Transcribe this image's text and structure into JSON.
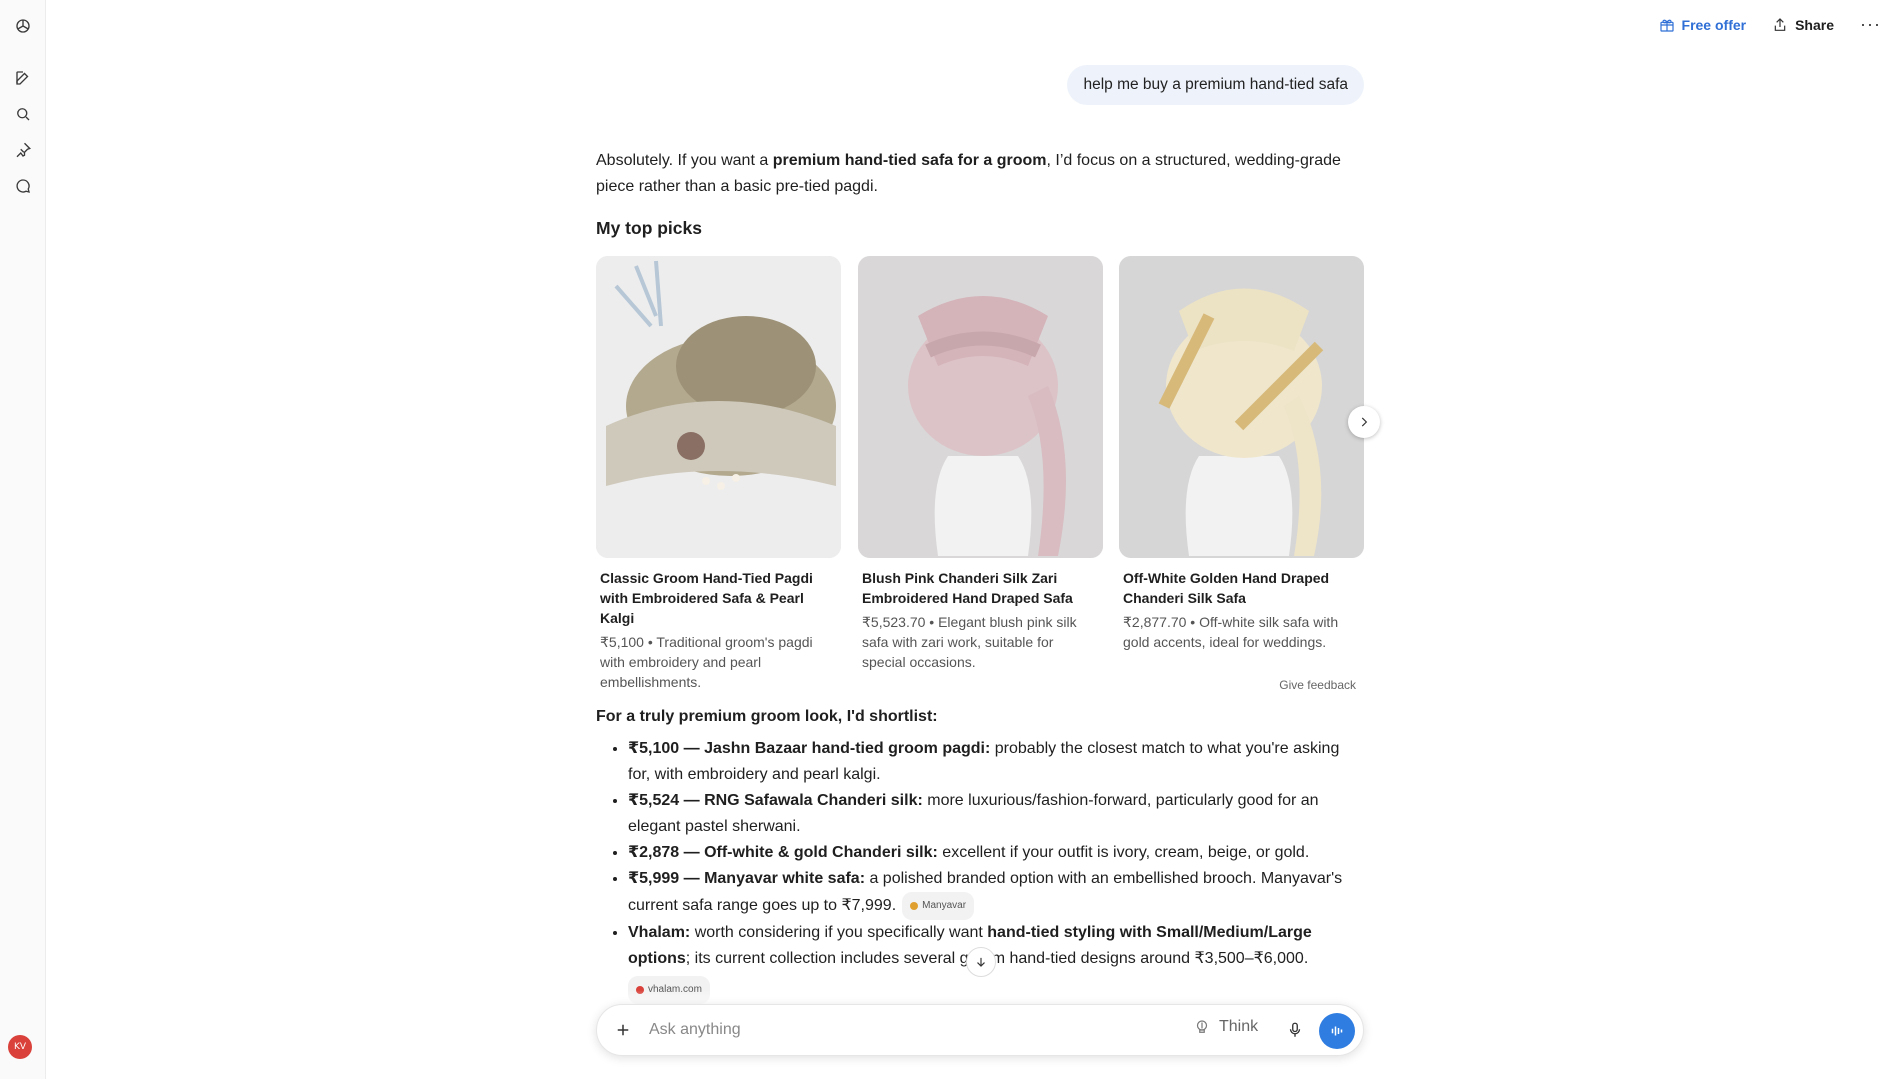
{
  "colors": {
    "accent": "#2f7de1",
    "link_blue": "#2f6fd6",
    "user_bubble_bg": "#eef3fb",
    "avatar_bg": "#d9413a"
  },
  "sidebar": {
    "logo_icon": "openai-logo-icon",
    "items": [
      {
        "icon": "new-chat-icon"
      },
      {
        "icon": "search-icon"
      },
      {
        "icon": "pin-icon"
      },
      {
        "icon": "chat-bubble-icon"
      }
    ],
    "avatar_initials": "KV"
  },
  "header": {
    "free_offer_label": "Free offer",
    "share_label": "Share",
    "more_label": "···"
  },
  "conversation": {
    "user_message": "help me buy a premium hand-tied safa",
    "intro": {
      "part1": "Absolutely. If you want a ",
      "bold": "premium hand-tied safa for a groom",
      "part2": ", I’d focus on a structured, wedding-grade piece rather than a basic pre-tied pagdi."
    },
    "top_picks_title": "My top picks",
    "products": [
      {
        "title": "Classic Groom Hand-Tied Pagdi with Embroidered Safa & Pearl Kalgi",
        "price": "₹5,100",
        "separator": " • ",
        "desc": "Traditional groom's pagdi with embroidery and pearl embellishments."
      },
      {
        "title": "Blush Pink Chanderi Silk Zari Embroidered Hand Draped Safa",
        "price": "₹5,523.70",
        "separator": " • ",
        "desc": "Elegant blush pink silk safa with zari work, suitable for special occasions."
      },
      {
        "title": "Off-White Golden Hand Draped Chanderi Silk Safa",
        "price": "₹2,877.70",
        "separator": " • ",
        "desc": "Off-white silk safa with gold accents, ideal for weddings."
      }
    ],
    "give_feedback_label": "Give feedback",
    "shortlist_title": "For a truly premium groom look, I'd shortlist:",
    "shortlist": [
      {
        "bold": "₹5,100 — Jashn Bazaar hand-tied groom pagdi:",
        "text": " probably the closest match to what you're asking for, with embroidery and pearl kalgi."
      },
      {
        "bold": "₹5,524 — RNG Safawala Chanderi silk:",
        "text": " more luxurious/fashion-forward, particularly good for an elegant pastel sherwani."
      },
      {
        "bold": "₹2,878 — Off-white & gold Chanderi silk:",
        "text": " excellent if your outfit is ivory, cream, beige, or gold."
      },
      {
        "bold": "₹5,999 — Manyavar white safa:",
        "text": " a polished branded option with an embellished brooch. Manyavar's current safa range goes up to ₹7,999.",
        "source": "Manyavar"
      },
      {
        "bold": "Vhalam:",
        "text": " worth considering if you specifically want ",
        "bold2": "hand-tied styling with Small/Medium/Large options",
        "text2": "; its current collection includes several groom hand-tied designs around ₹3,500–₹6,000.",
        "source": "vhalam.com"
      }
    ]
  },
  "composer": {
    "placeholder": "Ask anything",
    "think_label": "Think"
  }
}
